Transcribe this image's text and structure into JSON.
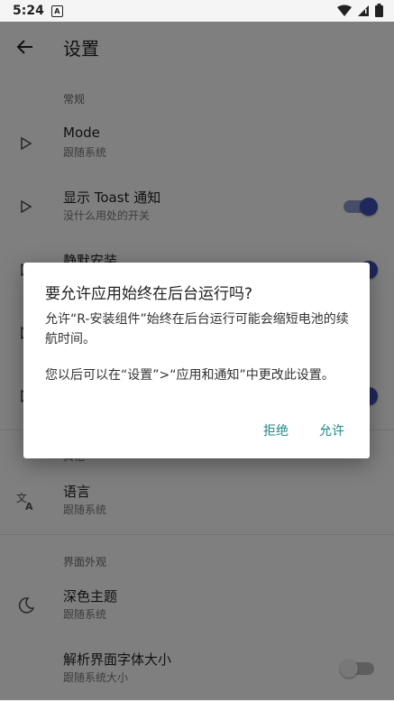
{
  "status": {
    "time": "5:24",
    "notif": "A"
  },
  "appbar": {
    "title": "设置"
  },
  "sections": {
    "general": "常规",
    "other": "其他",
    "appearance": "界面外观"
  },
  "items": [
    {
      "title": "Mode",
      "subtitle": "跟随系统"
    },
    {
      "title": "显示 Toast 通知",
      "subtitle": "没什么用处的开关"
    },
    {
      "title": "静默安装",
      "subtitle": ""
    },
    {
      "title": "语言",
      "subtitle": "跟随系统"
    },
    {
      "title": "深色主题",
      "subtitle": "跟随系统"
    },
    {
      "title": "解析界面字体大小",
      "subtitle": "跟随系统大小"
    }
  ],
  "dialog": {
    "title": "要允许应用始终在后台运行吗?",
    "message1": "允许“R-安装组件”始终在后台运行可能会缩短电池的续航时间。",
    "message2": "您以后可以在“设置”>“应用和通知”中更改此设置。",
    "deny": "拒绝",
    "allow": "允许"
  },
  "colors": {
    "accent": "#3f51b5",
    "dialog_button": "#1a8a84"
  }
}
